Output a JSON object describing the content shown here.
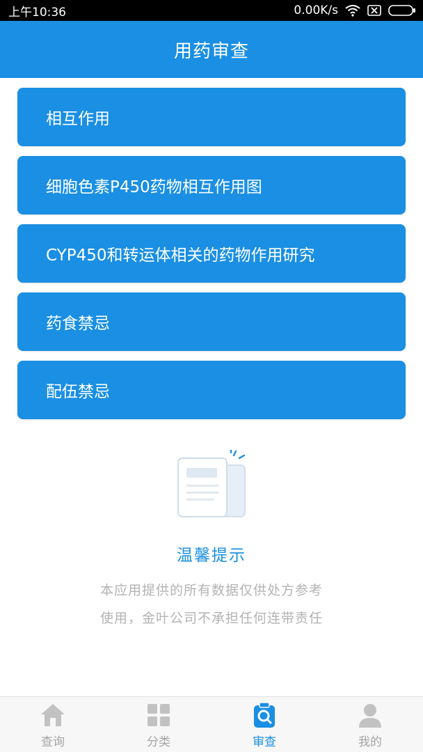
{
  "status_bar": {
    "time": "上午10:36",
    "network_speed": "0.00K/s",
    "icons": [
      "wifi-icon",
      "sim-blocked-icon",
      "battery-icon"
    ]
  },
  "header": {
    "title": "用药审查"
  },
  "menu": {
    "items": [
      {
        "label": "相互作用"
      },
      {
        "label": "细胞色素P450药物相互作用图"
      },
      {
        "label": "CYP450和转运体相关的药物作用研究"
      },
      {
        "label": "药食禁忌"
      },
      {
        "label": "配伍禁忌"
      }
    ]
  },
  "tip": {
    "icon": "document-icon",
    "title": "温馨提示",
    "line1": "本应用提供的所有数据仅供处方参考",
    "line2": "使用，金叶公司不承担任何连带责任"
  },
  "bottom_nav": {
    "items": [
      {
        "label": "查询",
        "icon": "home-icon",
        "active": false
      },
      {
        "label": "分类",
        "icon": "grid-icon",
        "active": false
      },
      {
        "label": "审查",
        "icon": "review-search-icon",
        "active": true
      },
      {
        "label": "我的",
        "icon": "user-icon",
        "active": false
      }
    ]
  },
  "colors": {
    "primary": "#1a8fe3",
    "status_bar": "#000000",
    "inactive": "#a5a5a5",
    "tip_text": "#b3b3b3"
  }
}
